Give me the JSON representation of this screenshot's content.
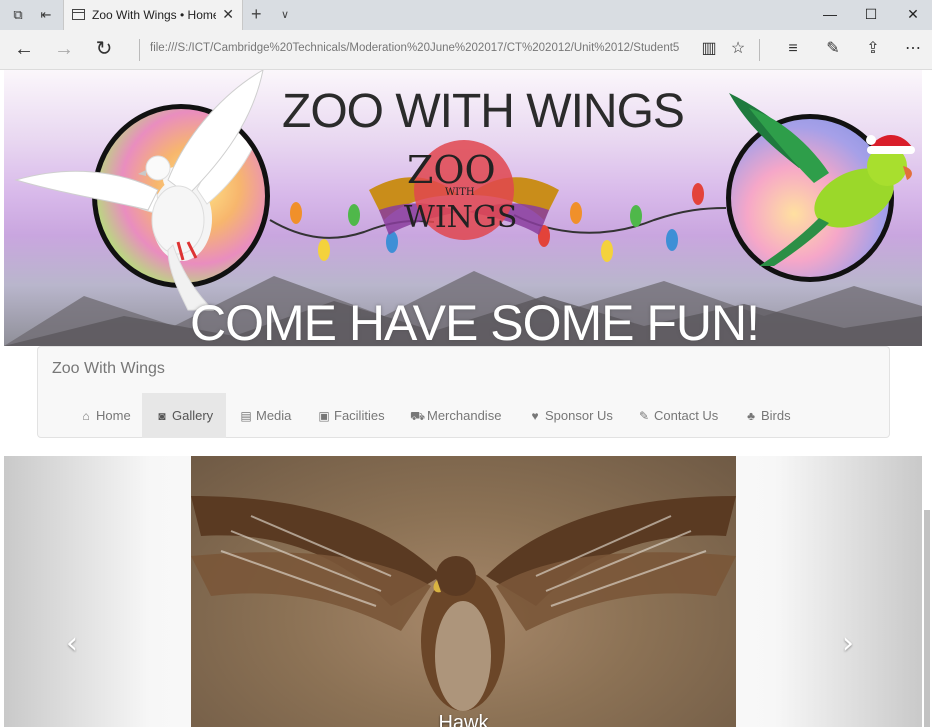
{
  "browser": {
    "tab_title": "Zoo With Wings • Home",
    "address": "file:///S:/ICT/Cambridge%20Technicals/Moderation%20June%202017/CT%202012/Unit%2012/Student5",
    "icons": [
      "tab-list-icon",
      "set-aside-icon",
      "page-icon",
      "close-icon",
      "plus-icon",
      "chevron-down-icon",
      "minimize-icon",
      "maximize-icon",
      "window-close-icon",
      "back-icon",
      "forward-icon",
      "refresh-icon",
      "reading-view-icon",
      "favorite-star-icon",
      "hub-icon",
      "notes-pen-icon",
      "share-icon",
      "more-icon"
    ]
  },
  "banner": {
    "title": "ZOO WITH WINGS",
    "logo_line1": "ZOO",
    "logo_line2": "WITH",
    "logo_line3": "WINGS",
    "tagline": "COME HAVE SOME FUN!"
  },
  "navbar": {
    "brand": "Zoo With Wings",
    "items": [
      {
        "label": "Home",
        "icon": "home-icon"
      },
      {
        "label": "Gallery",
        "icon": "camera-icon",
        "active": true
      },
      {
        "label": "Media",
        "icon": "film-icon"
      },
      {
        "label": "Facilities",
        "icon": "facilities-icon"
      },
      {
        "label": "Merchandise",
        "icon": "cart-icon"
      },
      {
        "label": "Sponsor Us",
        "icon": "heart-icon"
      },
      {
        "label": "Contact Us",
        "icon": "pencil-icon"
      },
      {
        "label": "Birds",
        "icon": "tree-icon"
      }
    ]
  },
  "carousel": {
    "caption": "Hawk",
    "prev": "‹",
    "next": "›"
  },
  "colors": {
    "nav_bg": "#f8f8f8",
    "nav_active": "#e7e7e7",
    "nav_text": "#777777"
  }
}
